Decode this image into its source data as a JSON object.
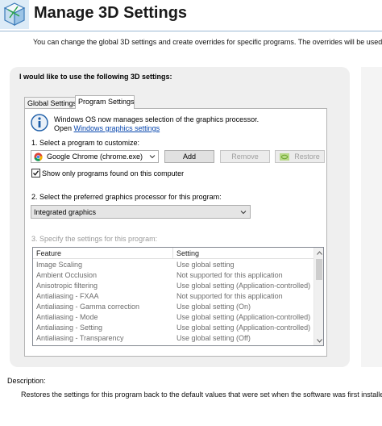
{
  "header": {
    "title": "Manage 3D Settings",
    "description": "You can change the global 3D settings and create overrides for specific programs. The overrides will be used au"
  },
  "panel": {
    "heading": "I would like to use the following 3D settings:"
  },
  "tabs": [
    {
      "label": "Global Settings",
      "selected": false
    },
    {
      "label": "Program Settings",
      "selected": true
    }
  ],
  "info": {
    "line1": "Windows OS now manages selection of the graphics processor.",
    "open_label": "Open",
    "link_text": "Windows graphics settings"
  },
  "step1": {
    "label": "1. Select a program to customize:",
    "selected_program": "Google Chrome (chrome.exe)",
    "add_label": "Add",
    "remove_label": "Remove",
    "restore_label": "Restore",
    "checkbox_label": "Show only programs found on this computer",
    "checkbox_checked": true
  },
  "step2": {
    "label": "2. Select the preferred graphics processor for this program:",
    "selected_gpu": "Integrated graphics"
  },
  "step3": {
    "label": "3. Specify the settings for this program:",
    "columns": {
      "feature": "Feature",
      "setting": "Setting"
    },
    "rows": [
      {
        "feature": "Image Scaling",
        "setting": "Use global setting"
      },
      {
        "feature": "Ambient Occlusion",
        "setting": "Not supported for this application"
      },
      {
        "feature": "Anisotropic filtering",
        "setting": "Use global setting (Application-controlled)"
      },
      {
        "feature": "Antialiasing - FXAA",
        "setting": "Not supported for this application"
      },
      {
        "feature": "Antialiasing - Gamma correction",
        "setting": "Use global setting (On)"
      },
      {
        "feature": "Antialiasing - Mode",
        "setting": "Use global setting (Application-controlled)"
      },
      {
        "feature": "Antialiasing - Setting",
        "setting": "Use global setting (Application-controlled)"
      },
      {
        "feature": "Antialiasing - Transparency",
        "setting": "Use global setting (Off)"
      }
    ]
  },
  "description": {
    "label": "Description:",
    "text": "Restores the settings for this program back to the default values that were set when the software was first installed."
  },
  "colors": {
    "accent_link": "#0645ad",
    "nvidia_green": "#76b900",
    "disabled_text": "#9b9b9b"
  },
  "icons": [
    "3d-settings-icon",
    "info-icon",
    "chrome-icon",
    "nvidia-restore-icon",
    "checkmark-icon",
    "dropdown-caret-icon",
    "scroll-up-icon",
    "scroll-down-icon"
  ]
}
